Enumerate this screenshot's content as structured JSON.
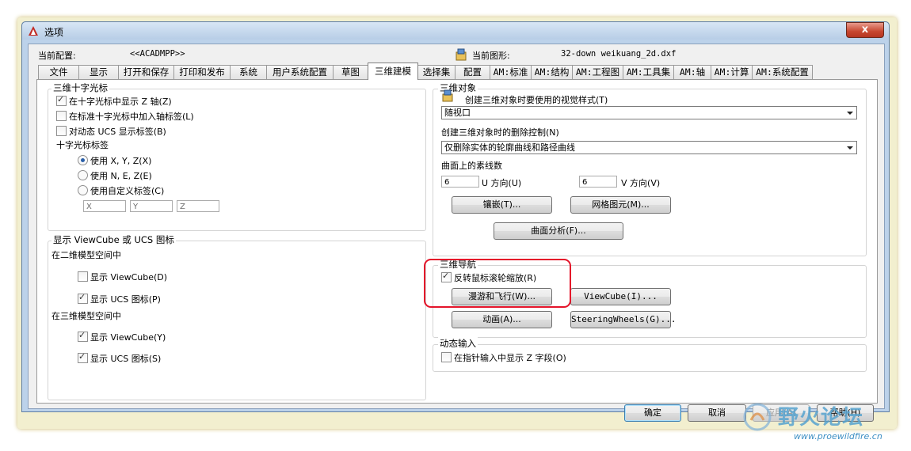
{
  "window": {
    "title": "选项",
    "close_label": "x"
  },
  "header": {
    "current_config_label": "当前配置:",
    "current_config_value": "<<ACADMPP>>",
    "current_drawing_label": "当前图形:",
    "current_drawing_value": "32-down weikuang_2d.dxf"
  },
  "tabs": [
    "文件",
    "显示",
    "打开和保存",
    "打印和发布",
    "系统",
    "用户系统配置",
    "草图",
    "三维建模",
    "选择集",
    "配置",
    "AM:标准",
    "AM:结构",
    "AM:工程图",
    "AM:工具集",
    "AM:轴",
    "AM:计算",
    "AM:系统配置"
  ],
  "active_tab": "三维建模",
  "crosshair": {
    "title": "三维十字光标",
    "cb1": "在十字光标中显示 Z 轴(Z)",
    "cb2": "在标准十字光标中加入轴标签(L)",
    "cb3": "对动态 UCS 显示标签(B)",
    "label_title": "十字光标标签",
    "rb1": "使用 X, Y, Z(X)",
    "rb2": "使用 N, E, Z(E)",
    "rb3": "使用自定义标签(C)",
    "in_x": "X",
    "in_y": "Y",
    "in_z": "Z"
  },
  "viewcube": {
    "title": "显示 ViewCube 或 UCS 图标",
    "sec2d": "在二维模型空间中",
    "cb2d_vc": "显示 ViewCube(D)",
    "cb2d_ucs": "显示 UCS 图标(P)",
    "sec3d": "在三维模型空间中",
    "cb3d_vc": "显示 ViewCube(Y)",
    "cb3d_ucs": "显示 UCS 图标(S)"
  },
  "objects3d": {
    "title": "三维对象",
    "visual_style_label": "创建三维对象时要使用的视觉样式(T)",
    "visual_style_value": "随视口",
    "delete_label": "创建三维对象时的删除控制(N)",
    "delete_value": "仅删除实体的轮廓曲线和路径曲线",
    "isolines_label": "曲面上的素线数",
    "u_value": "6",
    "u_label": "U 方向(U)",
    "v_value": "6",
    "v_label": "V 方向(V)",
    "tessellation_btn": "镶嵌(T)...",
    "mesh_btn": "网格图元(M)...",
    "surface_btn": "曲面分析(F)..."
  },
  "nav3d": {
    "title": "三维导航",
    "reverse_wheel": "反转鼠标滚轮缩放(R)",
    "walkfly_btn": "漫游和飞行(W)...",
    "viewcube_btn": "ViewCube(I)...",
    "animation_btn": "动画(A)...",
    "steering_btn": "SteeringWheels(G)..."
  },
  "dynamic_input": {
    "title": "动态输入",
    "show_z": "在指针输入中显示 Z 字段(O)"
  },
  "footer": {
    "ok": "确定",
    "cancel": "取消",
    "apply": "应用(A)",
    "help": "帮助(H)"
  },
  "watermark": {
    "text": "野火论坛",
    "url": "www.proewildfire.cn"
  }
}
